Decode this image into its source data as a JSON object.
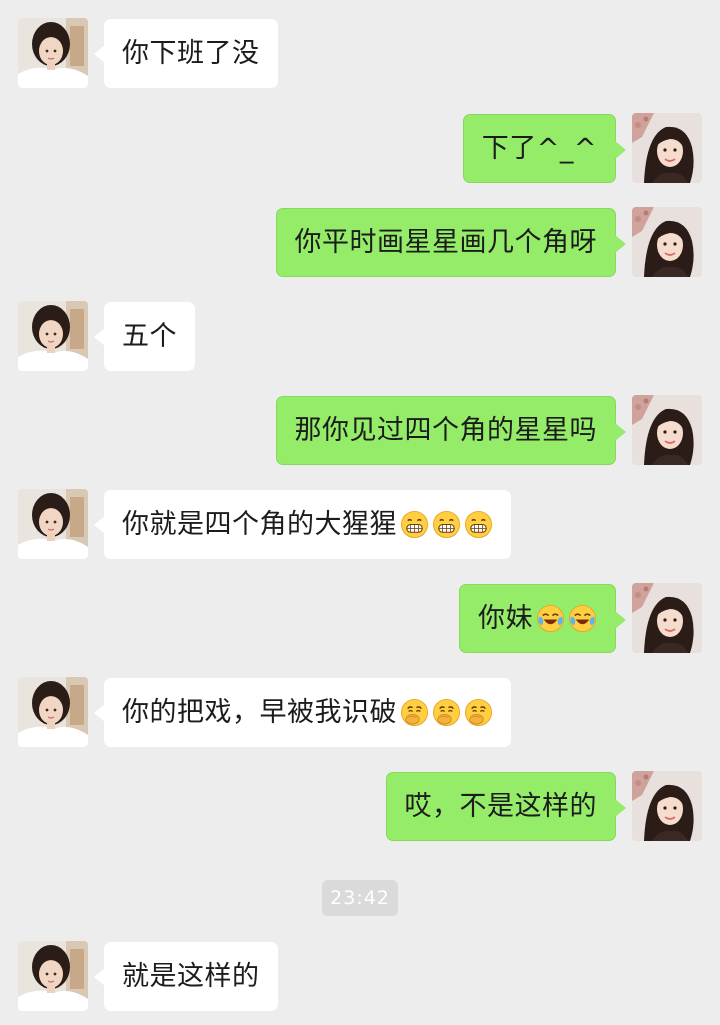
{
  "chat": {
    "messages": [
      {
        "side": "left",
        "text": "你下班了没",
        "emoji_icon": "",
        "emoji_count": 0
      },
      {
        "side": "right",
        "text": "下了^_^",
        "emoji_icon": "",
        "emoji_count": 0
      },
      {
        "side": "right",
        "text": "你平时画星星画几个角呀",
        "emoji_icon": "",
        "emoji_count": 0
      },
      {
        "side": "left",
        "text": "五个",
        "emoji_icon": "",
        "emoji_count": 0
      },
      {
        "side": "right",
        "text": "那你见过四个角的星星吗",
        "emoji_icon": "",
        "emoji_count": 0
      },
      {
        "side": "left",
        "text": "你就是四个角的大猩猩",
        "emoji_icon": "grin-emoji-icon",
        "emoji_count": 3
      },
      {
        "side": "right",
        "text": "你妹",
        "emoji_icon": "laugh-cry-emoji-icon",
        "emoji_count": 2
      },
      {
        "side": "left",
        "text": "你的把戏，早被我识破",
        "emoji_icon": "smirk-emoji-icon",
        "emoji_count": 3
      },
      {
        "side": "right",
        "text": "哎，不是这样的",
        "emoji_icon": "",
        "emoji_count": 0
      },
      {
        "side": "left",
        "text": "就是这样的",
        "emoji_icon": "",
        "emoji_count": 0
      }
    ],
    "timestamp": "23:42"
  },
  "colors": {
    "background": "#ededed",
    "incoming_bubble": "#ffffff",
    "outgoing_bubble": "#95ec69",
    "timestamp_pill": "#dadada"
  },
  "icons": {
    "avatar_left": "friend-avatar",
    "avatar_right": "self-avatar"
  }
}
